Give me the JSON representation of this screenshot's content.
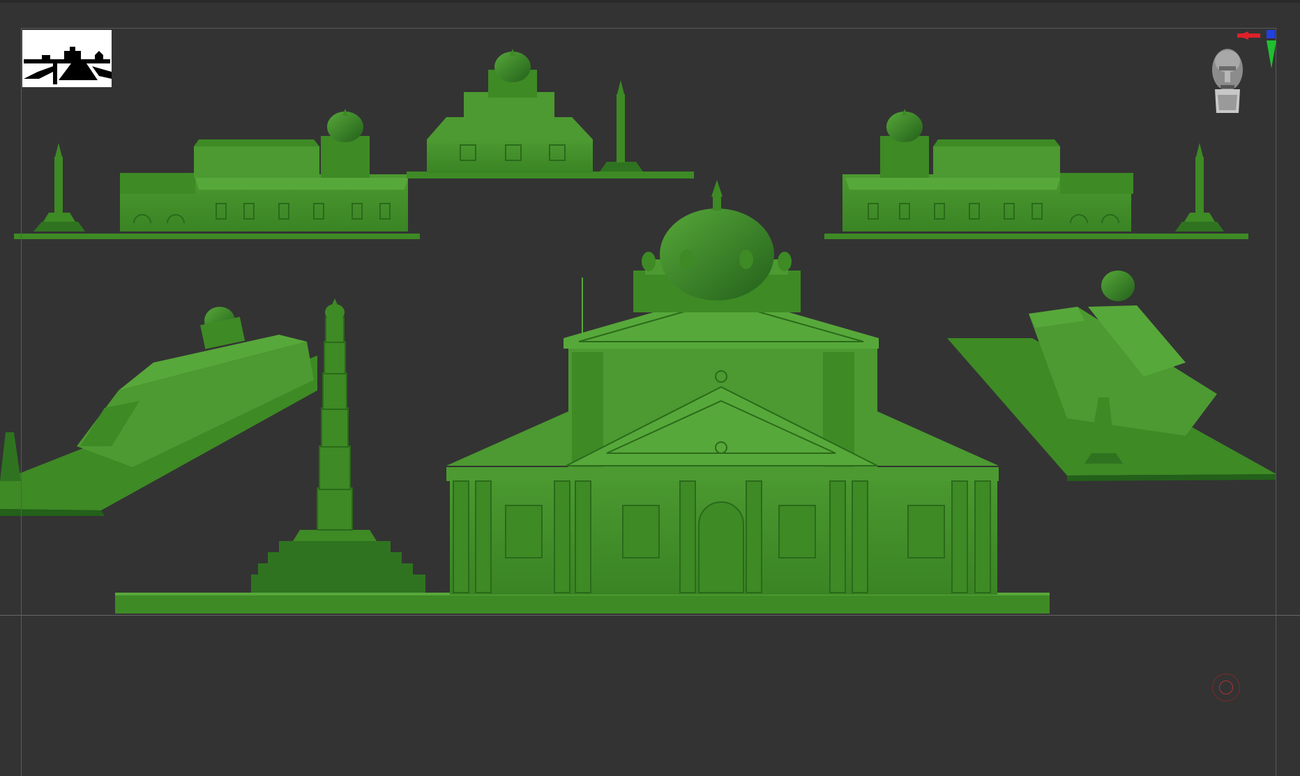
{
  "app": {
    "window_title": ""
  },
  "colors": {
    "background": "#333333",
    "model_green": "#3e8a25",
    "model_green_dark": "#23601a",
    "model_green_light": "#57a83a",
    "frame_line": "#5a5a5a",
    "axis_red": "#e0202a",
    "axis_green": "#20c030",
    "axis_blue": "#2040e0"
  },
  "icons": {
    "thumbnail": "silhouette-thumbnail-icon",
    "navigation": "head-gizmo-icon",
    "cursor": "brush-cursor-icon"
  }
}
